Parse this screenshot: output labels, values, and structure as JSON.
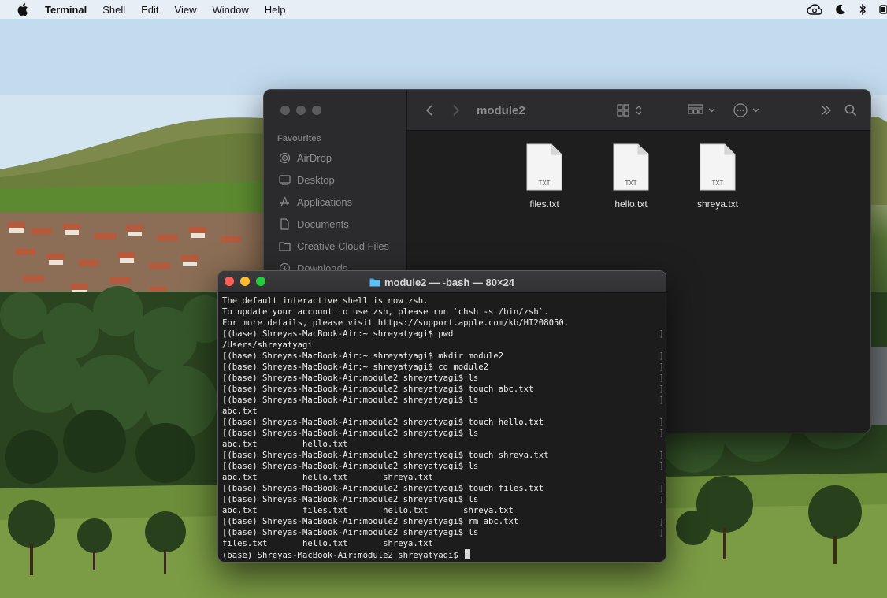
{
  "menubar": {
    "app_name": "Terminal",
    "items": [
      "Shell",
      "Edit",
      "View",
      "Window",
      "Help"
    ],
    "status_icons": [
      "creative-cloud-icon",
      "moon-icon",
      "bluetooth-icon",
      "battery-icon"
    ]
  },
  "finder": {
    "folder_title": "module2",
    "sidebar": {
      "section_title": "Favourites",
      "items": [
        {
          "label": "AirDrop",
          "icon": "airdrop-icon"
        },
        {
          "label": "Desktop",
          "icon": "desktop-icon"
        },
        {
          "label": "Applications",
          "icon": "applications-icon"
        },
        {
          "label": "Documents",
          "icon": "documents-icon"
        },
        {
          "label": "Creative Cloud Files",
          "icon": "folder-icon"
        },
        {
          "label": "Downloads",
          "icon": "downloads-icon"
        }
      ]
    },
    "files": [
      {
        "name": "files.txt",
        "type": "TXT"
      },
      {
        "name": "hello.txt",
        "type": "TXT"
      },
      {
        "name": "shreya.txt",
        "type": "TXT"
      }
    ]
  },
  "terminal": {
    "title": "module2 — -bash — 80×24",
    "lines": [
      {
        "text": "The default interactive shell is now zsh.",
        "mark": false
      },
      {
        "text": "To update your account to use zsh, please run `chsh -s /bin/zsh`.",
        "mark": false
      },
      {
        "text": "For more details, please visit https://support.apple.com/kb/HT208050.",
        "mark": false
      },
      {
        "text": "[(base) Shreyas-MacBook-Air:~ shreyatyagi$ pwd",
        "mark": true
      },
      {
        "text": "/Users/shreyatyagi",
        "mark": false
      },
      {
        "text": "[(base) Shreyas-MacBook-Air:~ shreyatyagi$ mkdir module2",
        "mark": true
      },
      {
        "text": "[(base) Shreyas-MacBook-Air:~ shreyatyagi$ cd module2",
        "mark": true
      },
      {
        "text": "[(base) Shreyas-MacBook-Air:module2 shreyatyagi$ ls",
        "mark": true
      },
      {
        "text": "[(base) Shreyas-MacBook-Air:module2 shreyatyagi$ touch abc.txt",
        "mark": true
      },
      {
        "text": "[(base) Shreyas-MacBook-Air:module2 shreyatyagi$ ls",
        "mark": true
      },
      {
        "text": "abc.txt",
        "mark": false
      },
      {
        "text": "[(base) Shreyas-MacBook-Air:module2 shreyatyagi$ touch hello.txt",
        "mark": true
      },
      {
        "text": "[(base) Shreyas-MacBook-Air:module2 shreyatyagi$ ls",
        "mark": true
      },
      {
        "text": "abc.txt         hello.txt",
        "mark": false
      },
      {
        "text": "[(base) Shreyas-MacBook-Air:module2 shreyatyagi$ touch shreya.txt",
        "mark": true
      },
      {
        "text": "[(base) Shreyas-MacBook-Air:module2 shreyatyagi$ ls",
        "mark": true
      },
      {
        "text": "abc.txt         hello.txt       shreya.txt",
        "mark": false
      },
      {
        "text": "[(base) Shreyas-MacBook-Air:module2 shreyatyagi$ touch files.txt",
        "mark": true
      },
      {
        "text": "[(base) Shreyas-MacBook-Air:module2 shreyatyagi$ ls",
        "mark": true
      },
      {
        "text": "abc.txt         files.txt       hello.txt       shreya.txt",
        "mark": false
      },
      {
        "text": "[(base) Shreyas-MacBook-Air:module2 shreyatyagi$ rm abc.txt",
        "mark": true
      },
      {
        "text": "[(base) Shreyas-MacBook-Air:module2 shreyatyagi$ ls",
        "mark": true
      },
      {
        "text": "files.txt       hello.txt       shreya.txt",
        "mark": false
      },
      {
        "text": "(base) Shreyas-MacBook-Air:module2 shreyatyagi$ ",
        "mark": false,
        "cursor": true
      }
    ]
  }
}
